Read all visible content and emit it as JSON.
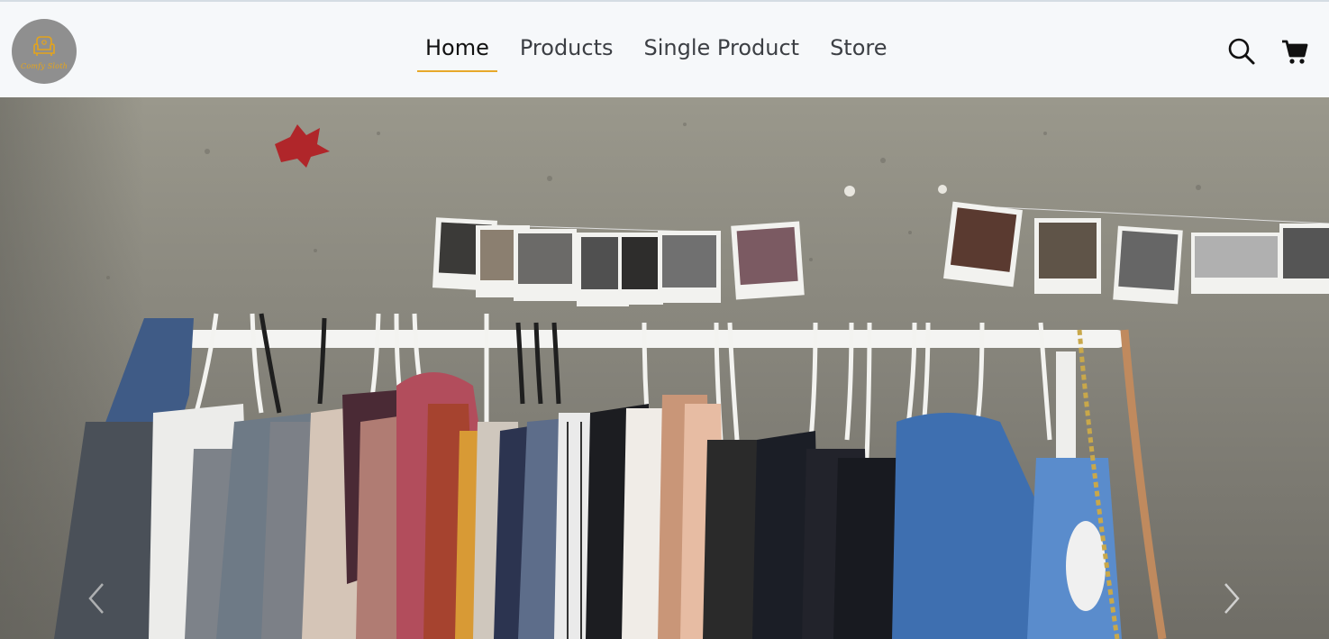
{
  "brand": {
    "logo_text": "Comfy Sloth",
    "accent_color": "#e7a92a",
    "logo_bg": "#8f8f8f"
  },
  "nav": {
    "links": [
      {
        "label": "Home",
        "active": true
      },
      {
        "label": "Products",
        "active": false
      },
      {
        "label": "Single Product",
        "active": false
      },
      {
        "label": "Store",
        "active": false
      }
    ],
    "icons": [
      "search-icon",
      "cart-icon"
    ]
  },
  "hero": {
    "image": "clothing-rack-on-concrete-wall",
    "controls": [
      "chevron-left-icon",
      "chevron-right-icon"
    ]
  }
}
